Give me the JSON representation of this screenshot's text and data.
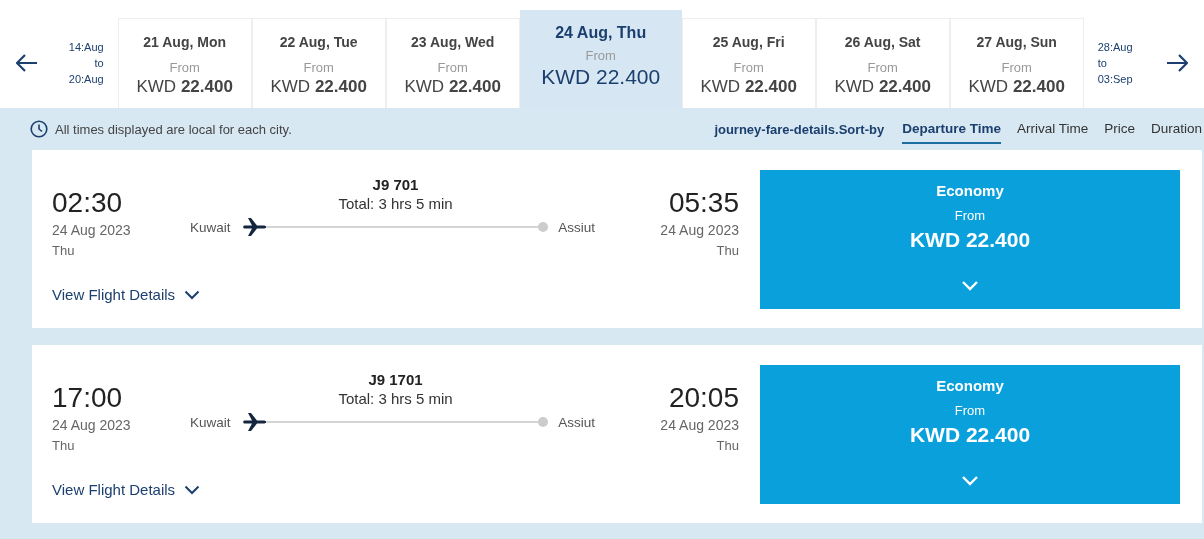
{
  "date_strip": {
    "previous_range": {
      "from": "14:Aug",
      "to_word": "to",
      "to": "20:Aug"
    },
    "days": [
      {
        "label": "21 Aug, Mon",
        "from": "From",
        "currency": "KWD",
        "amount": "22.400",
        "selected": false
      },
      {
        "label": "22 Aug, Tue",
        "from": "From",
        "currency": "KWD",
        "amount": "22.400",
        "selected": false
      },
      {
        "label": "23 Aug, Wed",
        "from": "From",
        "currency": "KWD",
        "amount": "22.400",
        "selected": false
      },
      {
        "label": "24 Aug, Thu",
        "from": "From",
        "currency": "KWD",
        "amount": "22.400",
        "selected": true
      },
      {
        "label": "25 Aug, Fri",
        "from": "From",
        "currency": "KWD",
        "amount": "22.400",
        "selected": false
      },
      {
        "label": "26 Aug, Sat",
        "from": "From",
        "currency": "KWD",
        "amount": "22.400",
        "selected": false
      },
      {
        "label": "27 Aug, Sun",
        "from": "From",
        "currency": "KWD",
        "amount": "22.400",
        "selected": false
      }
    ],
    "next_range": {
      "from": "28:Aug",
      "to_word": "to",
      "to": "03:Sep"
    }
  },
  "notice": "All times displayed are local for each city.",
  "sort": {
    "label": "journey-fare-details.Sort-by",
    "options": [
      {
        "label": "Departure Time",
        "selected": true
      },
      {
        "label": "Arrival Time",
        "selected": false
      },
      {
        "label": "Price",
        "selected": false
      },
      {
        "label": "Duration",
        "selected": false
      }
    ]
  },
  "flights": [
    {
      "departure_time": "02:30",
      "departure_date": "24 Aug 2023",
      "departure_day": "Thu",
      "flight_number": "J9 701",
      "total": "Total: 3 hrs 5 min",
      "origin": "Kuwait",
      "destination": "Assiut",
      "arrival_time": "05:35",
      "arrival_date": "24 Aug 2023",
      "arrival_day": "Thu",
      "details_link": "View Flight Details",
      "fare": {
        "cabin": "Economy",
        "from": "From",
        "price": "KWD 22.400"
      }
    },
    {
      "departure_time": "17:00",
      "departure_date": "24 Aug 2023",
      "departure_day": "Thu",
      "flight_number": "J9 1701",
      "total": "Total: 3 hrs 5 min",
      "origin": "Kuwait",
      "destination": "Assiut",
      "arrival_time": "20:05",
      "arrival_date": "24 Aug 2023",
      "arrival_day": "Thu",
      "details_link": "View Flight Details",
      "fare": {
        "cabin": "Economy",
        "from": "From",
        "price": "KWD 22.400"
      }
    }
  ]
}
